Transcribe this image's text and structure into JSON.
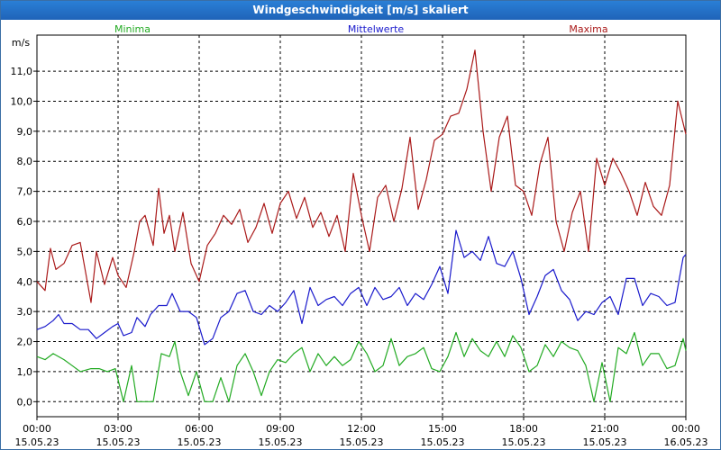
{
  "window": {
    "title": "Windgeschwindigkeit [m/s] skaliert"
  },
  "chart_data": {
    "type": "line",
    "title": "Windgeschwindigkeit [m/s] skaliert",
    "ylabel": "m/s",
    "ylim": [
      -0.5,
      12.2
    ],
    "yticks": [
      0,
      1,
      2,
      3,
      4,
      5,
      6,
      7,
      8,
      9,
      10,
      11
    ],
    "ytick_labels": [
      "0,0",
      "1,0",
      "2,0",
      "3,0",
      "4,0",
      "5,0",
      "6,0",
      "7,0",
      "8,0",
      "9,0",
      "10,0",
      "11,0"
    ],
    "xlim": [
      0,
      24
    ],
    "xticks": [
      {
        "h": 0,
        "time": "00:00",
        "date": "15.05.23"
      },
      {
        "h": 3,
        "time": "03:00",
        "date": "15.05.23"
      },
      {
        "h": 6,
        "time": "06:00",
        "date": "15.05.23"
      },
      {
        "h": 9,
        "time": "09:00",
        "date": "15.05.23"
      },
      {
        "h": 12,
        "time": "12:00",
        "date": "15.05.23"
      },
      {
        "h": 15,
        "time": "15:00",
        "date": "15.05.23"
      },
      {
        "h": 18,
        "time": "18:00",
        "date": "15.05.23"
      },
      {
        "h": 21,
        "time": "21:00",
        "date": "15.05.23"
      },
      {
        "h": 24,
        "time": "00:00",
        "date": "16.05.23"
      }
    ],
    "grid": true,
    "legend_placement": "top",
    "series": [
      {
        "name": "Minima",
        "color": "#22aa22",
        "points": [
          [
            0,
            1.5
          ],
          [
            0.3,
            1.4
          ],
          [
            0.6,
            1.6
          ],
          [
            1.0,
            1.4
          ],
          [
            1.3,
            1.2
          ],
          [
            1.6,
            1.0
          ],
          [
            2.0,
            1.1
          ],
          [
            2.3,
            1.1
          ],
          [
            2.6,
            1.0
          ],
          [
            2.9,
            1.1
          ],
          [
            3.2,
            0.0
          ],
          [
            3.5,
            1.2
          ],
          [
            3.7,
            0.0
          ],
          [
            4.0,
            0.0
          ],
          [
            4.3,
            0.0
          ],
          [
            4.6,
            1.6
          ],
          [
            4.9,
            1.5
          ],
          [
            5.1,
            2.0
          ],
          [
            5.3,
            1.0
          ],
          [
            5.6,
            0.2
          ],
          [
            5.9,
            1.0
          ],
          [
            6.2,
            0.0
          ],
          [
            6.5,
            0.0
          ],
          [
            6.8,
            0.8
          ],
          [
            7.1,
            0.0
          ],
          [
            7.4,
            1.2
          ],
          [
            7.7,
            1.6
          ],
          [
            8.0,
            1.0
          ],
          [
            8.3,
            0.2
          ],
          [
            8.6,
            1.0
          ],
          [
            8.9,
            1.4
          ],
          [
            9.2,
            1.3
          ],
          [
            9.5,
            1.6
          ],
          [
            9.8,
            1.8
          ],
          [
            10.1,
            1.0
          ],
          [
            10.4,
            1.6
          ],
          [
            10.7,
            1.2
          ],
          [
            11.0,
            1.5
          ],
          [
            11.3,
            1.2
          ],
          [
            11.6,
            1.4
          ],
          [
            11.9,
            2.0
          ],
          [
            12.2,
            1.6
          ],
          [
            12.5,
            1.0
          ],
          [
            12.8,
            1.2
          ],
          [
            13.1,
            2.1
          ],
          [
            13.4,
            1.2
          ],
          [
            13.7,
            1.5
          ],
          [
            14.0,
            1.6
          ],
          [
            14.3,
            1.8
          ],
          [
            14.6,
            1.1
          ],
          [
            14.9,
            1.0
          ],
          [
            15.2,
            1.5
          ],
          [
            15.5,
            2.3
          ],
          [
            15.8,
            1.5
          ],
          [
            16.1,
            2.1
          ],
          [
            16.4,
            1.7
          ],
          [
            16.7,
            1.5
          ],
          [
            17.0,
            2.0
          ],
          [
            17.3,
            1.5
          ],
          [
            17.6,
            2.2
          ],
          [
            17.9,
            1.8
          ],
          [
            18.2,
            1.0
          ],
          [
            18.5,
            1.2
          ],
          [
            18.8,
            1.9
          ],
          [
            19.1,
            1.5
          ],
          [
            19.4,
            2.0
          ],
          [
            19.7,
            1.8
          ],
          [
            20.0,
            1.7
          ],
          [
            20.3,
            1.2
          ],
          [
            20.6,
            0.0
          ],
          [
            20.9,
            1.3
          ],
          [
            21.2,
            0.0
          ],
          [
            21.5,
            1.8
          ],
          [
            21.8,
            1.6
          ],
          [
            22.1,
            2.3
          ],
          [
            22.4,
            1.2
          ],
          [
            22.7,
            1.6
          ],
          [
            23.0,
            1.6
          ],
          [
            23.3,
            1.1
          ],
          [
            23.6,
            1.2
          ],
          [
            23.9,
            2.1
          ],
          [
            24.0,
            1.7
          ]
        ]
      },
      {
        "name": "Mittelwerte",
        "color": "#1a1acc",
        "points": [
          [
            0,
            2.4
          ],
          [
            0.3,
            2.5
          ],
          [
            0.6,
            2.7
          ],
          [
            0.8,
            2.9
          ],
          [
            1.0,
            2.6
          ],
          [
            1.3,
            2.6
          ],
          [
            1.6,
            2.4
          ],
          [
            1.9,
            2.4
          ],
          [
            2.2,
            2.1
          ],
          [
            2.5,
            2.3
          ],
          [
            2.8,
            2.5
          ],
          [
            3.0,
            2.6
          ],
          [
            3.2,
            2.2
          ],
          [
            3.5,
            2.3
          ],
          [
            3.7,
            2.8
          ],
          [
            4.0,
            2.5
          ],
          [
            4.2,
            2.9
          ],
          [
            4.5,
            3.2
          ],
          [
            4.8,
            3.2
          ],
          [
            5.0,
            3.6
          ],
          [
            5.3,
            3.0
          ],
          [
            5.6,
            3.0
          ],
          [
            5.9,
            2.8
          ],
          [
            6.2,
            1.9
          ],
          [
            6.5,
            2.1
          ],
          [
            6.8,
            2.8
          ],
          [
            7.1,
            3.0
          ],
          [
            7.4,
            3.6
          ],
          [
            7.7,
            3.7
          ],
          [
            8.0,
            3.0
          ],
          [
            8.3,
            2.9
          ],
          [
            8.6,
            3.2
          ],
          [
            8.9,
            3.0
          ],
          [
            9.2,
            3.3
          ],
          [
            9.5,
            3.7
          ],
          [
            9.8,
            2.6
          ],
          [
            10.1,
            3.8
          ],
          [
            10.4,
            3.2
          ],
          [
            10.7,
            3.4
          ],
          [
            11.0,
            3.5
          ],
          [
            11.3,
            3.2
          ],
          [
            11.6,
            3.6
          ],
          [
            11.9,
            3.8
          ],
          [
            12.2,
            3.2
          ],
          [
            12.5,
            3.8
          ],
          [
            12.8,
            3.4
          ],
          [
            13.1,
            3.5
          ],
          [
            13.4,
            3.8
          ],
          [
            13.7,
            3.2
          ],
          [
            14.0,
            3.6
          ],
          [
            14.3,
            3.4
          ],
          [
            14.6,
            3.9
          ],
          [
            14.9,
            4.5
          ],
          [
            15.2,
            3.6
          ],
          [
            15.5,
            5.7
          ],
          [
            15.8,
            4.8
          ],
          [
            16.1,
            5.0
          ],
          [
            16.4,
            4.7
          ],
          [
            16.7,
            5.5
          ],
          [
            17.0,
            4.6
          ],
          [
            17.3,
            4.5
          ],
          [
            17.6,
            5.0
          ],
          [
            17.9,
            4.1
          ],
          [
            18.2,
            2.9
          ],
          [
            18.5,
            3.5
          ],
          [
            18.8,
            4.2
          ],
          [
            19.1,
            4.4
          ],
          [
            19.4,
            3.7
          ],
          [
            19.7,
            3.4
          ],
          [
            20.0,
            2.7
          ],
          [
            20.3,
            3.0
          ],
          [
            20.6,
            2.9
          ],
          [
            20.9,
            3.3
          ],
          [
            21.2,
            3.5
          ],
          [
            21.5,
            2.9
          ],
          [
            21.8,
            4.1
          ],
          [
            22.1,
            4.1
          ],
          [
            22.4,
            3.2
          ],
          [
            22.7,
            3.6
          ],
          [
            23.0,
            3.5
          ],
          [
            23.3,
            3.2
          ],
          [
            23.6,
            3.3
          ],
          [
            23.9,
            4.8
          ],
          [
            24.0,
            4.9
          ]
        ]
      },
      {
        "name": "Maxima",
        "color": "#aa1a1a",
        "points": [
          [
            0,
            4.0
          ],
          [
            0.3,
            3.7
          ],
          [
            0.5,
            5.1
          ],
          [
            0.7,
            4.4
          ],
          [
            1.0,
            4.6
          ],
          [
            1.3,
            5.2
          ],
          [
            1.6,
            5.3
          ],
          [
            1.8,
            4.3
          ],
          [
            2.0,
            3.3
          ],
          [
            2.2,
            5.0
          ],
          [
            2.5,
            3.9
          ],
          [
            2.8,
            4.8
          ],
          [
            3.0,
            4.2
          ],
          [
            3.3,
            3.8
          ],
          [
            3.6,
            5.0
          ],
          [
            3.8,
            6.0
          ],
          [
            4.0,
            6.2
          ],
          [
            4.3,
            5.2
          ],
          [
            4.5,
            7.1
          ],
          [
            4.7,
            5.6
          ],
          [
            4.9,
            6.2
          ],
          [
            5.1,
            5.0
          ],
          [
            5.4,
            6.3
          ],
          [
            5.7,
            4.6
          ],
          [
            6.0,
            4.0
          ],
          [
            6.3,
            5.2
          ],
          [
            6.6,
            5.6
          ],
          [
            6.9,
            6.2
          ],
          [
            7.2,
            5.9
          ],
          [
            7.5,
            6.4
          ],
          [
            7.8,
            5.3
          ],
          [
            8.1,
            5.8
          ],
          [
            8.4,
            6.6
          ],
          [
            8.7,
            5.6
          ],
          [
            9.0,
            6.6
          ],
          [
            9.3,
            7.0
          ],
          [
            9.6,
            6.1
          ],
          [
            9.9,
            6.8
          ],
          [
            10.2,
            5.8
          ],
          [
            10.5,
            6.3
          ],
          [
            10.8,
            5.5
          ],
          [
            11.1,
            6.2
          ],
          [
            11.4,
            5.0
          ],
          [
            11.7,
            7.6
          ],
          [
            12.0,
            6.2
          ],
          [
            12.3,
            5.0
          ],
          [
            12.6,
            6.8
          ],
          [
            12.9,
            7.2
          ],
          [
            13.2,
            6.0
          ],
          [
            13.5,
            7.1
          ],
          [
            13.8,
            8.8
          ],
          [
            14.1,
            6.4
          ],
          [
            14.4,
            7.4
          ],
          [
            14.7,
            8.7
          ],
          [
            15.0,
            8.9
          ],
          [
            15.3,
            9.5
          ],
          [
            15.6,
            9.6
          ],
          [
            15.9,
            10.4
          ],
          [
            16.2,
            11.7
          ],
          [
            16.5,
            9.0
          ],
          [
            16.8,
            7.0
          ],
          [
            17.1,
            8.8
          ],
          [
            17.4,
            9.5
          ],
          [
            17.7,
            7.2
          ],
          [
            18.0,
            7.0
          ],
          [
            18.3,
            6.2
          ],
          [
            18.6,
            7.9
          ],
          [
            18.9,
            8.8
          ],
          [
            19.2,
            6.0
          ],
          [
            19.5,
            5.0
          ],
          [
            19.8,
            6.3
          ],
          [
            20.1,
            7.0
          ],
          [
            20.4,
            5.0
          ],
          [
            20.7,
            8.1
          ],
          [
            21.0,
            7.2
          ],
          [
            21.3,
            8.1
          ],
          [
            21.6,
            7.6
          ],
          [
            21.9,
            7.0
          ],
          [
            22.2,
            6.2
          ],
          [
            22.5,
            7.3
          ],
          [
            22.8,
            6.5
          ],
          [
            23.1,
            6.2
          ],
          [
            23.4,
            7.2
          ],
          [
            23.7,
            10.0
          ],
          [
            24.0,
            8.9
          ]
        ]
      }
    ]
  }
}
